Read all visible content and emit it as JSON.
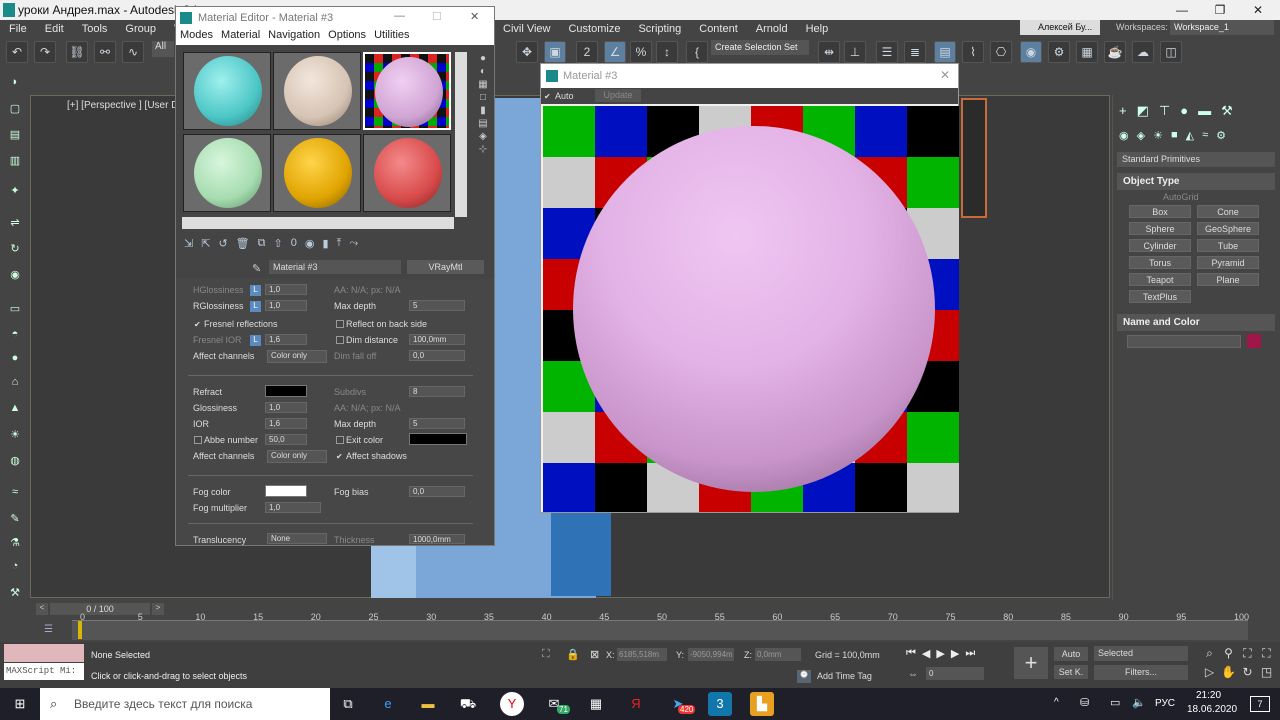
{
  "app": {
    "window_title": "уроки Андрея.max - Autodesk 3ds",
    "user": "Алексей Бу...",
    "workspace_label": "Workspaces:",
    "workspace": "Workspace_1"
  },
  "menu": [
    "File",
    "Edit",
    "Tools",
    "Group",
    "View",
    "Civil View",
    "Customize",
    "Scripting",
    "Content",
    "Arnold",
    "Help"
  ],
  "toolbar": {
    "selection_filter": "All",
    "selection_set": "Create Selection Set"
  },
  "viewport": {
    "label": "[+] [Perspective ] [User D"
  },
  "material_editor": {
    "title": "Material Editor - Material #3",
    "menu": [
      "Modes",
      "Material",
      "Navigation",
      "Options",
      "Utilities"
    ],
    "material_name": "Material #3",
    "material_type": "VRayMtl",
    "params": {
      "hglossiness": "HGlossiness",
      "hglossiness_val": "1,0",
      "aa1": "AA: N/A; px: N/A",
      "rglossiness": "RGlossiness",
      "rglossiness_val": "1,0",
      "max_depth": "Max depth",
      "max_depth_val": "5",
      "fresnel": "Fresnel reflections",
      "reflect_back": "Reflect on back side",
      "fresnel_ior": "Fresnel IOR",
      "fresnel_ior_val": "1,6",
      "dim_distance": "Dim distance",
      "dim_distance_val": "100,0mm",
      "affect_channels": "Affect channels",
      "color_only": "Color only",
      "dim_falloff": "Dim fall off",
      "dim_falloff_val": "0,0",
      "refract": "Refract",
      "subdivs": "Subdivs",
      "subdivs_val": "8",
      "glossiness": "Glossiness",
      "glossiness_val": "1,0",
      "aa2": "AA: N/A; px: N/A",
      "ior": "IOR",
      "ior_val": "1,6",
      "max_depth2": "Max depth",
      "max_depth2_val": "5",
      "abbe": "Abbe number",
      "abbe_val": "50,0",
      "exit_color": "Exit color",
      "affect_channels2": "Affect channels",
      "color_only2": "Color only",
      "affect_shadows": "Affect shadows",
      "fog_color": "Fog color",
      "fog_bias": "Fog bias",
      "fog_bias_val": "0,0",
      "fog_mult": "Fog multiplier",
      "fog_mult_val": "1,0",
      "translucency": "Translucency",
      "translucency_val": "None",
      "thickness": "Thickness",
      "thickness_val": "1000,0mm"
    }
  },
  "preview": {
    "title": "Material #3",
    "auto": "Auto",
    "update": "Update"
  },
  "command_panel": {
    "dropdown": "Standard Primitives",
    "object_type": "Object Type",
    "autogrid": "AutoGrid",
    "buttons": [
      "Box",
      "Cone",
      "Sphere",
      "GeoSphere",
      "Cylinder",
      "Tube",
      "Torus",
      "Pyramid",
      "Teapot",
      "Plane",
      "TextPlus"
    ],
    "name_and_color": "Name and Color",
    "color": "#a0154a"
  },
  "timeline": {
    "frame": "0 / 100",
    "ticks": [
      "0",
      "5",
      "10",
      "15",
      "20",
      "25",
      "30",
      "35",
      "40",
      "45",
      "50",
      "55",
      "60",
      "65",
      "70",
      "75",
      "80",
      "85",
      "90",
      "95",
      "100"
    ]
  },
  "status": {
    "maxscript": "MAXScript Mi:",
    "selected": "None Selected",
    "hint": "Click or click-and-drag to select objects",
    "x_label": "X:",
    "x_val": "6185,518m",
    "y_label": "Y:",
    "y_val": "-9050,994m",
    "z_label": "Z:",
    "z_val": "0,0mm",
    "grid": "Grid = 100,0mm",
    "add_time_tag": "Add Time Tag",
    "auto": "Auto",
    "selected_dd": "Selected",
    "setk": "Set K.",
    "filters": "Filters...",
    "frame_val": "0"
  },
  "taskbar": {
    "search": "Введите здесь текст для поиска",
    "lang": "РУС",
    "time": "21:20",
    "date": "18.06.2020",
    "notif": "7",
    "badge1": "71",
    "badge2": "420"
  }
}
